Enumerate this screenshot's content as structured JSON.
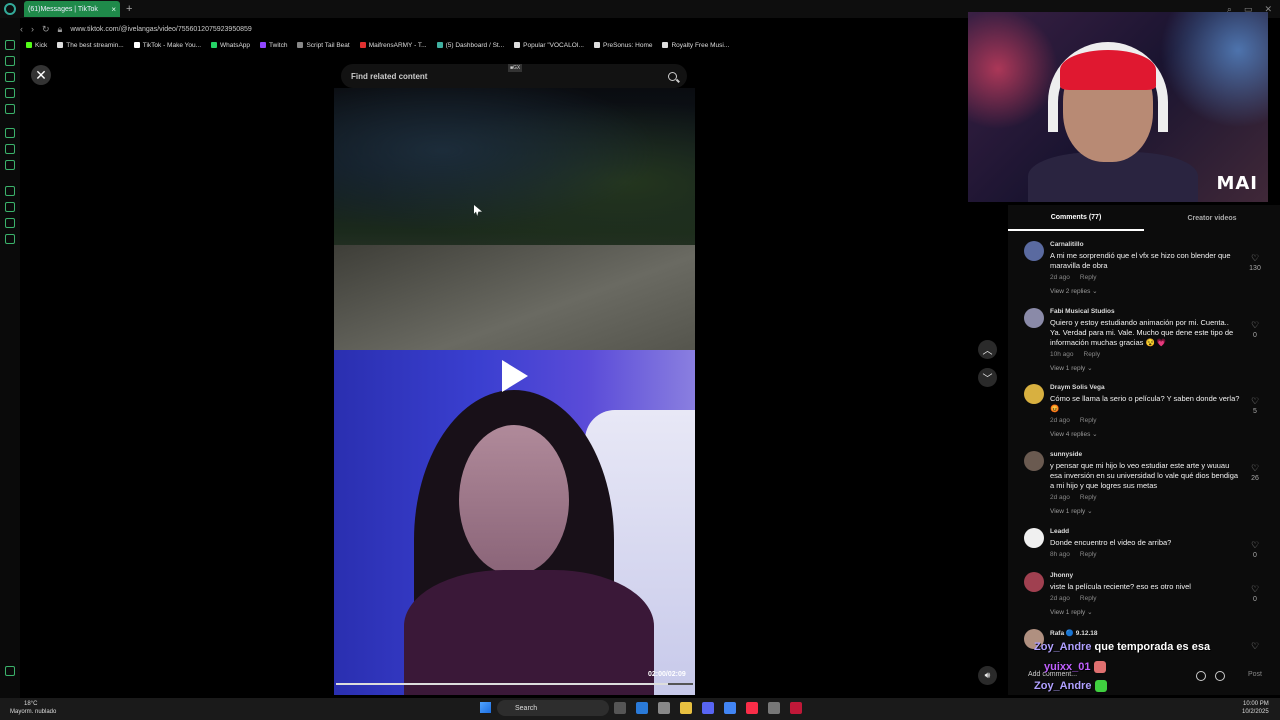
{
  "browser": {
    "tab_title": "(61)Messages | TikTok",
    "tab_close": "×",
    "new_tab": "+",
    "url": "www.tiktok.com/@ivelangas/video/7556012075923950859",
    "bookmarks": [
      {
        "label": "Kick",
        "color": "#53fc18"
      },
      {
        "label": "The best streamin...",
        "color": "#dddddd"
      },
      {
        "label": "TikTok - Make You...",
        "color": "#ffffff"
      },
      {
        "label": "WhatsApp",
        "color": "#25d366"
      },
      {
        "label": "Twitch",
        "color": "#9146ff"
      },
      {
        "label": "Script Tail Beat",
        "color": "#888888"
      },
      {
        "label": "MaifrensARMY - T...",
        "color": "#e03030"
      },
      {
        "label": "(5) Dashboard / St...",
        "color": "#3fb0a0"
      },
      {
        "label": "Popular \"VOCALOI...",
        "color": "#dddddd"
      },
      {
        "label": "PreSonus: Home",
        "color": "#dddddd"
      },
      {
        "label": "Royalty Free Musi...",
        "color": "#dddddd"
      }
    ]
  },
  "viewer": {
    "close_label": "✕",
    "search_placeholder": "Find related content",
    "mini_tag": "■GX",
    "timecode": "02:00/02:09",
    "progress": 0.93
  },
  "webcam": {
    "logo": "MAI"
  },
  "panel": {
    "tabs": [
      "Comments (77)",
      "Creator videos"
    ],
    "comments": [
      {
        "user": "Carnalitillo",
        "text": "A mi me sorprendió que el vfx se hizo con blender que maravilla de obra",
        "time": "2d ago",
        "reply": "Reply",
        "replies": "View 2 replies ⌄",
        "likes": "130",
        "avatar": "#5a6aa0"
      },
      {
        "user": "Fabi Musical Studios",
        "text": "Quiero y estoy estudiando animación por mi. Cuenta.. Ya. Verdad para mi. Vale. Mucho que dene este tipo de información muchas gracias 😵 💗",
        "time": "10h ago",
        "reply": "Reply",
        "replies": "View 1 reply ⌄",
        "likes": "0",
        "avatar": "#8a8aa8"
      },
      {
        "user": "Draym Solis Vega",
        "text": "Cómo se llama la serio o película? Y saben donde verla? 😡",
        "time": "2d ago",
        "reply": "Reply",
        "replies": "View 4 replies ⌄",
        "likes": "5",
        "avatar": "#d8b040"
      },
      {
        "user": "sunnyside",
        "text": "y pensar que mi hijo lo veo estudiar este arte y wuuau esa inversión en su universidad lo vale qué dios bendiga a mi hijo y que logres sus metas",
        "time": "2d ago",
        "reply": "Reply",
        "replies": "View 1 reply ⌄",
        "likes": "26",
        "avatar": "#6a5a50"
      },
      {
        "user": "Leadd",
        "text": "Donde encuentro el video de arriba?",
        "time": "8h ago",
        "reply": "Reply",
        "replies": "",
        "likes": "0",
        "avatar": "#f0f0f0"
      },
      {
        "user": "Jhonny",
        "text": "viste la película reciente? eso es otro nivel",
        "time": "2d ago",
        "reply": "Reply",
        "replies": "View 1 reply ⌄",
        "likes": "0",
        "avatar": "#a04050"
      },
      {
        "user": "Rafa 🔵 9.12.18",
        "text": "",
        "time": "",
        "reply": "",
        "replies": "",
        "likes": "",
        "avatar": "#b09080"
      }
    ],
    "add_comment": "Add comment...",
    "post": "Post"
  },
  "chat": [
    {
      "user": "Zoy_Andre",
      "message": "que temporada es esa",
      "color": "#b0a0ff"
    },
    {
      "user": "yuixx_01",
      "message": "",
      "color": "#c060ff"
    },
    {
      "user": "Zoy_Andre",
      "message": "",
      "color": "#b0a0ff"
    }
  ],
  "taskbar": {
    "weather_temp": "18°C",
    "weather_desc": "Mayorm. nublado",
    "search": "Search",
    "time": "10:00 PM",
    "date": "10/2/2025"
  }
}
